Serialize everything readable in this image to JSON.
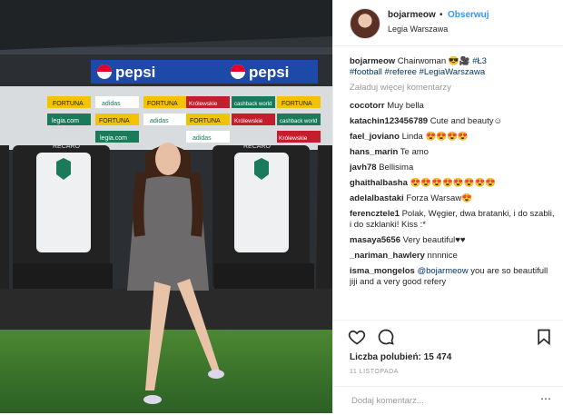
{
  "post": {
    "username": "bojarmeow",
    "follow_label": "Obserwuj",
    "separator": "•",
    "location": "Legia Warszawa",
    "caption": {
      "user": "bojarmeow",
      "text": "Chairwoman 😎🎥 ",
      "hashtags_line1": "#Ł3",
      "hashtags_line2": "#football #referee #LegiaWarszawa"
    },
    "load_more": "Załaduj więcej komentarzy",
    "comments": [
      {
        "user": "cocotorr",
        "text": "Muy bella"
      },
      {
        "user": "katachin123456789",
        "text": "Cute and beauty☺"
      },
      {
        "user": "fael_joviano",
        "text": "Linda 😍😍😍😍"
      },
      {
        "user": "hans_marin",
        "text": "Te amo"
      },
      {
        "user": "javh78",
        "text": "Bellisima"
      },
      {
        "user": "ghaithalbasha",
        "text": "😍😍😍😍😍😍😍😍"
      },
      {
        "user": "adelalbastaki",
        "text": "Forza Warsaw😍"
      },
      {
        "user": "ferencztele1",
        "text": "Polak, Węgier, dwa bratanki, i do szabli, i do szklanki! Kiss :*"
      },
      {
        "user": "masaya5656",
        "text": "Very beautiful♥♥"
      },
      {
        "user": "_nariman_hawlery",
        "text": "nnnnice"
      },
      {
        "user": "isma_mongelos",
        "mention": "@bojarmeow",
        "text": " you are so beautifull jiji and a very good refery"
      }
    ],
    "likes_label": "Liczba polubień: 15 474",
    "date": "11 LISTOPADA",
    "add_comment_placeholder": "Dodaj komentarz...",
    "more_label": "⋯"
  },
  "photo": {
    "sponsor_main": "pepsi",
    "board_labels": [
      "FORTUNA",
      "adidas",
      "FORTUNA",
      "Królewskie",
      "cashback world",
      "FORTUNA",
      "legia.com",
      "FORTUNA",
      "adidas",
      "FORTUNA",
      "Królewskie",
      "cashback world",
      "legia.com",
      "adidas",
      "Królewskie"
    ],
    "seat_brand": "RECARO"
  },
  "icons": {
    "like": "heart-icon",
    "comment": "comment-icon",
    "save": "bookmark-icon",
    "more": "more-options-icon"
  },
  "colors": {
    "link": "#3897f0",
    "hashtag": "#003569",
    "muted": "#999999",
    "pepsi_blue": "#1d4aa8"
  }
}
